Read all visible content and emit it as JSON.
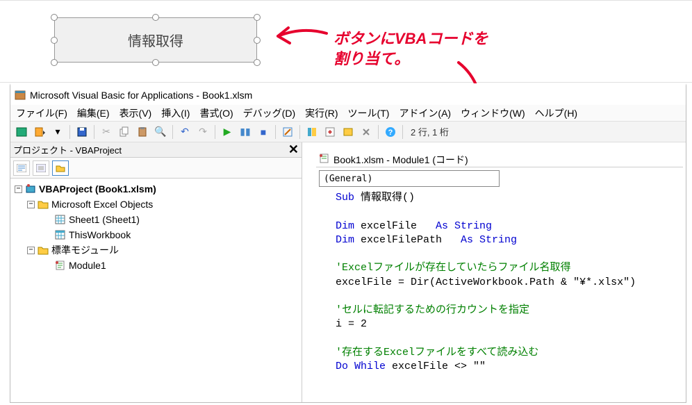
{
  "excel_button": {
    "label": "情報取得"
  },
  "annotation": {
    "line1": "ボタンにVBAコードを",
    "line2": "割り当て。"
  },
  "titlebar": {
    "text": "Microsoft Visual Basic for Applications - Book1.xlsm"
  },
  "menubar": {
    "file": "ファイル(F)",
    "edit": "編集(E)",
    "view": "表示(V)",
    "insert": "挿入(I)",
    "format": "書式(O)",
    "debug": "デバッグ(D)",
    "run": "実行(R)",
    "tools": "ツール(T)",
    "addins": "アドイン(A)",
    "window": "ウィンドウ(W)",
    "help": "ヘルプ(H)"
  },
  "toolbar": {
    "status": "2 行, 1 桁"
  },
  "project_pane": {
    "title": "プロジェクト - VBAProject",
    "tree": {
      "root": "VBAProject (Book1.xlsm)",
      "excel_objects": "Microsoft Excel Objects",
      "sheet1": "Sheet1 (Sheet1)",
      "thisworkbook": "ThisWorkbook",
      "std_modules": "標準モジュール",
      "module1": "Module1"
    }
  },
  "code_window": {
    "title": "Book1.xlsm - Module1 (コード)",
    "combo": "(General)",
    "code": {
      "l1_sub": "Sub",
      "l1_name": " 情報取得()",
      "l2_dim": "Dim",
      "l2_rest": " excelFile   ",
      "l2_as": "As String",
      "l3_dim": "Dim",
      "l3_rest": " excelFilePath   ",
      "l3_as": "As String",
      "l4": "'Excelファイルが存在していたらファイル名取得",
      "l5a": "excelFile = Dir(ActiveWorkbook.Path & ",
      "l5b": "\"¥*.xlsx\"",
      "l5c": ")",
      "l6": "'セルに転記するための行カウントを指定",
      "l7": "i = 2",
      "l8": "'存在するExcelファイルをすべて読み込む",
      "l9a": "Do While",
      "l9b": " excelFile <> ",
      "l9c": "\"\""
    }
  }
}
